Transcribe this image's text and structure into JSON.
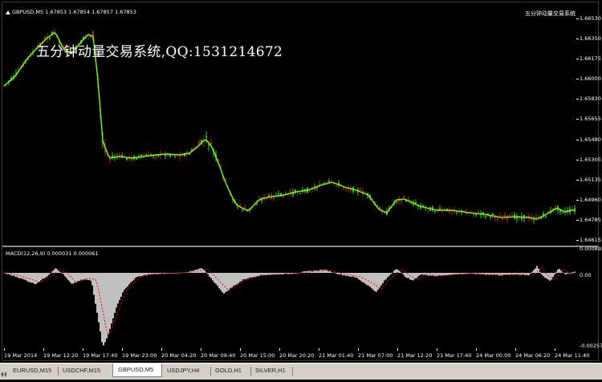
{
  "header": {
    "symbol_line": "GBPUSD,M5  1.67853 1.67854 1.67857 1.67853",
    "indicator_name": "五分钟动量交易系统"
  },
  "watermark": "五分钟动量交易系统,QQ:1531214672",
  "macd_header": "MACD(12,26,9) 0.000031 0.000061",
  "price_axis": {
    "labels": [
      "1.66530",
      "1.66350",
      "1.66175",
      "1.66000",
      "1.65830",
      "1.65655",
      "1.65480",
      "1.65305",
      "1.65135",
      "1.64960",
      "1.64785",
      "1.64615"
    ]
  },
  "macd_axis": {
    "labels": [
      "0.000892",
      "0.00",
      "-0.002578"
    ]
  },
  "time_axis": {
    "labels": [
      "19 Mar 2014",
      "19 Mar 12:20",
      "19 Mar 17:40",
      "19 Mar 23:00",
      "20 Mar 04:20",
      "20 Mar 09:40",
      "20 Mar 15:00",
      "20 Mar 20:20",
      "21 Mar 01:40",
      "21 Mar 07:00",
      "21 Mar 12:20",
      "21 Mar 17:40",
      "24 Mar 00:00",
      "24 Mar 06:20",
      "24 Mar 11:40"
    ]
  },
  "tabs": [
    {
      "label": "EURUSD,M15",
      "active": false
    },
    {
      "label": "USDCHF,M15",
      "active": false
    },
    {
      "label": "GBPUSD,M5",
      "active": true
    },
    {
      "label": "USDJPY,H4",
      "active": false
    },
    {
      "label": "GOLD,H1",
      "active": false
    },
    {
      "label": "SILVER,H1",
      "active": false
    }
  ],
  "colors": {
    "background": "#000000",
    "bull_candle": "#32cd32",
    "bear_candle": "#b22222",
    "moving_average": "#7cfc00",
    "macd_histogram": "#c0c0c0",
    "macd_signal": "#ff0000",
    "tab_bar": "#d4d0c8"
  }
}
